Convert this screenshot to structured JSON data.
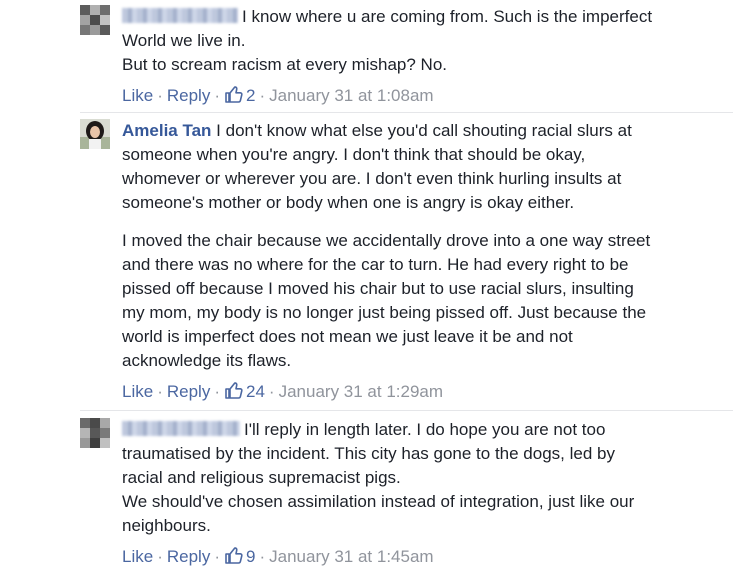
{
  "comments": [
    {
      "author": "",
      "paragraphs": [
        "I know where u are coming from. Such is the imperfect\nWorld we live in.\nBut to scream racism at every mishap? No."
      ],
      "actions": {
        "like": "Like",
        "reply": "Reply",
        "likes": "2",
        "time": "January 31 at 1:08am"
      }
    },
    {
      "author": "Amelia Tan",
      "paragraphs": [
        "I don't know what else you'd call shouting racial slurs at\nsomeone when you're angry. I don't think that should be okay,\nwhomever or wherever you are. I don't even think hurling insults at\nsomeone's mother or body when one is angry is okay either.",
        "I moved the chair because we accidentally drove into a one way street\nand there was no where for the car to turn. He had every right to be\npissed off because I moved his chair but to use racial slurs, insulting\nmy mom, my body is no longer just being pissed off. Just because the\nworld is imperfect does not mean we just leave it be and not\nacknowledge its flaws."
      ],
      "actions": {
        "like": "Like",
        "reply": "Reply",
        "likes": "24",
        "time": "January 31 at 1:29am"
      }
    },
    {
      "author": "",
      "paragraphs": [
        "I'll reply in length later. I do hope you are not too\ntraumatised by the incident. This city has gone to the dogs, led by\nracial and religious supremacist pigs.\nWe should've chosen assimilation instead of integration, just like our\nneighbours."
      ],
      "actions": {
        "like": "Like",
        "reply": "Reply",
        "likes": "9",
        "time": "January 31 at 1:45am"
      }
    }
  ],
  "icons": {
    "like_count": "thumbs-up-outline",
    "avatar_blur": "pixelated"
  },
  "colors": {
    "link": "#4b67a1",
    "name": "#365899",
    "meta": "#90949c",
    "text": "#1d2129"
  }
}
